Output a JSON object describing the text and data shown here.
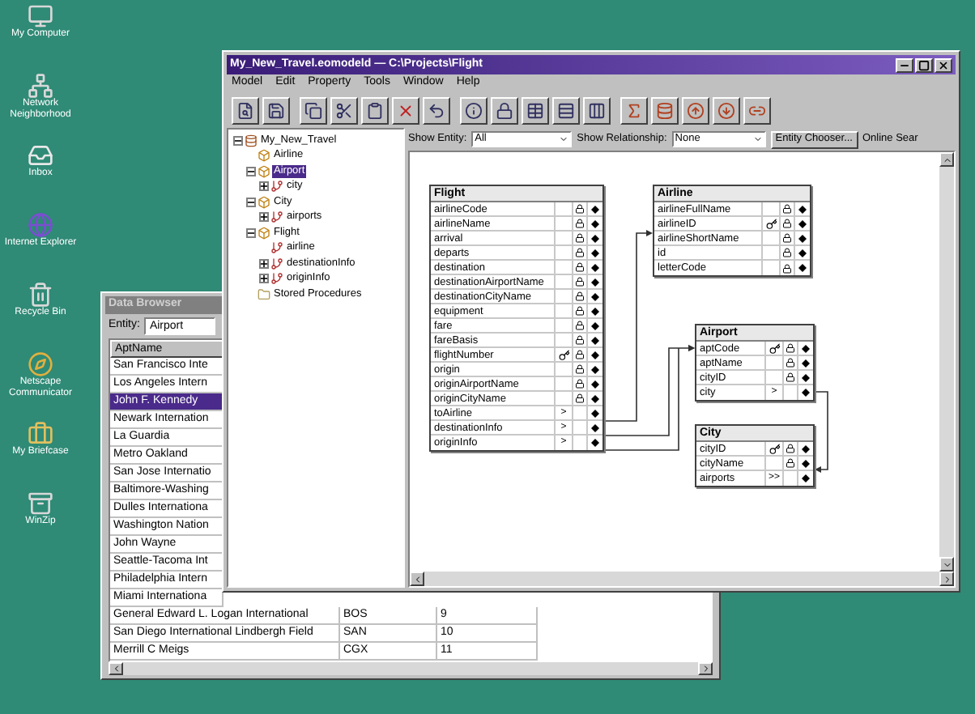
{
  "desktop_icons": [
    {
      "label": "My Computer"
    },
    {
      "label": "Network Neighborhood"
    },
    {
      "label": "Inbox"
    },
    {
      "label": "Internet Explorer"
    },
    {
      "label": "Recycle Bin"
    },
    {
      "label": "Netscape Communicator"
    },
    {
      "label": "My Briefcase"
    },
    {
      "label": "WinZip"
    }
  ],
  "data_browser": {
    "title": "Data Browser",
    "entity_label": "Entity:",
    "entity_value": "Airport",
    "columns": [
      "AptName"
    ],
    "rows": [
      {
        "cells": [
          "San Francisco Inte"
        ],
        "selected": false
      },
      {
        "cells": [
          "Los Angeles Intern"
        ],
        "selected": false
      },
      {
        "cells": [
          "John F. Kennedy"
        ],
        "selected": true
      },
      {
        "cells": [
          "Newark Internation"
        ],
        "selected": false
      },
      {
        "cells": [
          "La Guardia"
        ],
        "selected": false
      },
      {
        "cells": [
          "Metro Oakland"
        ],
        "selected": false
      },
      {
        "cells": [
          "San Jose Internatio"
        ],
        "selected": false
      },
      {
        "cells": [
          "Baltimore-Washing"
        ],
        "selected": false
      },
      {
        "cells": [
          "Dulles Internationa"
        ],
        "selected": false
      },
      {
        "cells": [
          "Washington Nation"
        ],
        "selected": false
      },
      {
        "cells": [
          "John Wayne"
        ],
        "selected": false
      },
      {
        "cells": [
          "Seattle-Tacoma Int"
        ],
        "selected": false
      },
      {
        "cells": [
          "Philadelphia Intern"
        ],
        "selected": false
      },
      {
        "cells": [
          "Miami Internationa"
        ],
        "selected": false
      },
      {
        "cells": [
          "General Edward L. Logan International",
          "BOS",
          "9"
        ],
        "selected": false
      },
      {
        "cells": [
          "San Diego International Lindbergh Field",
          "SAN",
          "10"
        ],
        "selected": false
      },
      {
        "cells": [
          "Merrill C Meigs",
          "CGX",
          "11"
        ],
        "selected": false
      }
    ]
  },
  "main_window": {
    "title": "My_New_Travel.eomodeld — C:\\Projects\\Flight",
    "menu": [
      "Model",
      "Edit",
      "Property",
      "Tools",
      "Window",
      "Help"
    ],
    "tree": [
      {
        "label": "My_New_Travel",
        "kind": "model",
        "selected": false,
        "expanded": true,
        "children": [
          {
            "label": "Airline",
            "kind": "entity",
            "selected": false
          },
          {
            "label": "Airport",
            "kind": "entity",
            "selected": true,
            "expanded": true,
            "children": [
              {
                "label": "city",
                "kind": "relationship",
                "selected": false,
                "expanded": false
              }
            ]
          },
          {
            "label": "City",
            "kind": "entity",
            "selected": false,
            "expanded": true,
            "children": [
              {
                "label": "airports",
                "kind": "relationship",
                "selected": false,
                "expanded": false
              }
            ]
          },
          {
            "label": "Flight",
            "kind": "entity",
            "selected": false,
            "expanded": true,
            "children": [
              {
                "label": "airline",
                "kind": "relationship",
                "selected": false
              },
              {
                "label": "destinationInfo",
                "kind": "relationship",
                "selected": false,
                "expanded": false
              },
              {
                "label": "originInfo",
                "kind": "relationship",
                "selected": false,
                "expanded": false
              }
            ]
          },
          {
            "label": "Stored Procedures",
            "kind": "folder",
            "selected": false
          }
        ]
      }
    ],
    "show_entity": {
      "label": "Show Entity:",
      "value": "All"
    },
    "show_relationship": {
      "label": "Show Relationship:",
      "value": "None"
    },
    "entity_chooser": "Entity Chooser...",
    "online_search": "Online Sear",
    "entities": [
      {
        "name": "Flight",
        "attributes": [
          {
            "name": "airlineCode",
            "kind": "attribute",
            "key": false
          },
          {
            "name": "airlineName",
            "kind": "attribute",
            "key": false
          },
          {
            "name": "arrival",
            "kind": "attribute",
            "key": false
          },
          {
            "name": "departs",
            "kind": "attribute",
            "key": false
          },
          {
            "name": "destination",
            "kind": "attribute",
            "key": false
          },
          {
            "name": "destinationAirportName",
            "kind": "attribute",
            "key": false
          },
          {
            "name": "destinationCityName",
            "kind": "attribute",
            "key": false
          },
          {
            "name": "equipment",
            "kind": "attribute",
            "key": false
          },
          {
            "name": "fare",
            "kind": "attribute",
            "key": false
          },
          {
            "name": "fareBasis",
            "kind": "attribute",
            "key": false
          },
          {
            "name": "flightNumber",
            "kind": "attribute",
            "key": true
          },
          {
            "name": "origin",
            "kind": "attribute",
            "key": false
          },
          {
            "name": "originAirportName",
            "kind": "attribute",
            "key": false
          },
          {
            "name": "originCityName",
            "kind": "attribute",
            "key": false
          },
          {
            "name": "toAirline",
            "kind": "relationship",
            "marker": ">"
          },
          {
            "name": "destinationInfo",
            "kind": "relationship",
            "marker": ">"
          },
          {
            "name": "originInfo",
            "kind": "relationship",
            "marker": ">"
          }
        ]
      },
      {
        "name": "Airline",
        "attributes": [
          {
            "name": "airlineFullName",
            "kind": "attribute",
            "key": false
          },
          {
            "name": "airlineID",
            "kind": "attribute",
            "key": true
          },
          {
            "name": "airlineShortName",
            "kind": "attribute",
            "key": false
          },
          {
            "name": "id",
            "kind": "attribute",
            "key": false
          },
          {
            "name": "letterCode",
            "kind": "attribute",
            "key": false
          }
        ]
      },
      {
        "name": "Airport",
        "attributes": [
          {
            "name": "aptCode",
            "kind": "attribute",
            "key": true
          },
          {
            "name": "aptName",
            "kind": "attribute",
            "key": false
          },
          {
            "name": "cityID",
            "kind": "attribute",
            "key": false
          },
          {
            "name": "city",
            "kind": "relationship",
            "marker": ">"
          }
        ]
      },
      {
        "name": "City",
        "attributes": [
          {
            "name": "cityID",
            "kind": "attribute",
            "key": true
          },
          {
            "name": "cityName",
            "kind": "attribute",
            "key": false
          },
          {
            "name": "airports",
            "kind": "relationship",
            "marker": ">>"
          }
        ]
      }
    ]
  }
}
